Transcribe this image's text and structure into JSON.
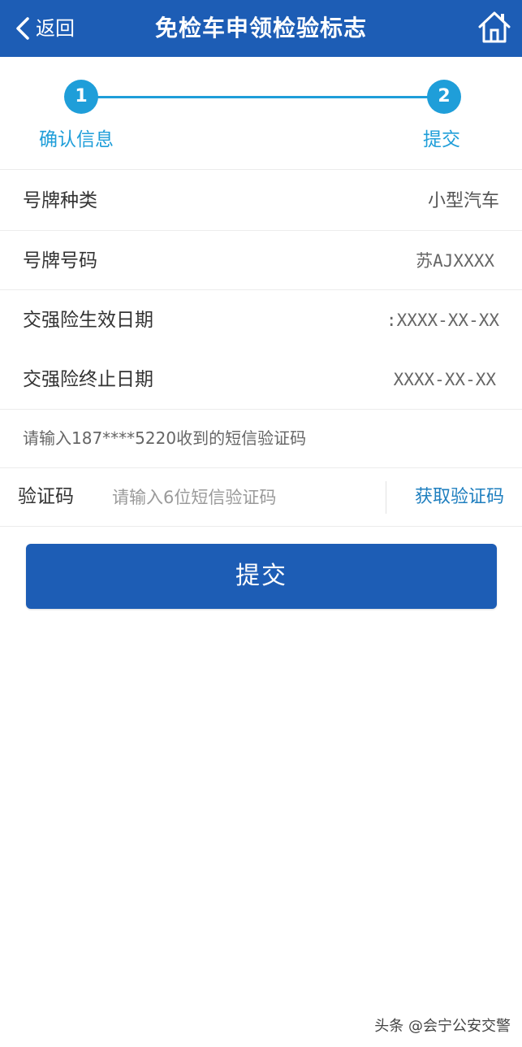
{
  "header": {
    "back_label": "返回",
    "title": "免检车申领检验标志",
    "back_icon": "chevron-left-icon",
    "home_icon": "home-icon"
  },
  "stepper": {
    "steps": [
      {
        "number": "1",
        "label": "确认信息"
      },
      {
        "number": "2",
        "label": "提交"
      }
    ],
    "accent_color": "#1f9ed9"
  },
  "info": {
    "rows": [
      {
        "label": "号牌种类",
        "value": "小型汽车"
      },
      {
        "label": "号牌号码",
        "value": "苏AJXXXX"
      },
      {
        "label": "交强险生效日期",
        "value": ":XXXX-XX-XX"
      },
      {
        "label": "交强险终止日期",
        "value": "XXXX-XX-XX"
      }
    ]
  },
  "sms": {
    "hint": "请输入187****5220收到的短信验证码",
    "code_label": "验证码",
    "code_placeholder": "请输入6位短信验证码",
    "code_value": "",
    "get_code_label": "获取验证码"
  },
  "submit_label": "提交",
  "watermark": "头条 @会宁公安交警",
  "colors": {
    "header_bg": "#1d5db5",
    "link": "#1f7fbf"
  }
}
